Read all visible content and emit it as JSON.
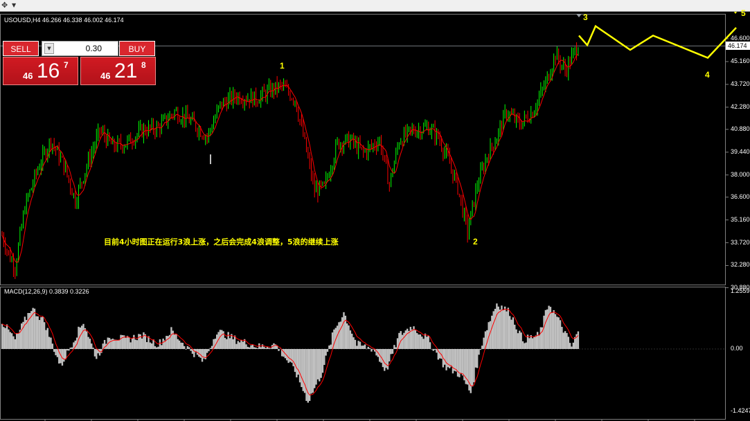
{
  "window": {
    "icon": "crosshair-icon",
    "menu_chevron": "chevron-down-icon"
  },
  "chart_header": {
    "symbol_text": "USOUSD,H4  46.266 46.338 46.002 46.174"
  },
  "trade_panel": {
    "sell_label": "SELL",
    "buy_label": "BUY",
    "lot_value": "0.30",
    "sell_price": {
      "prefix": "46",
      "big": "16",
      "sup": "7"
    },
    "buy_price": {
      "prefix": "46",
      "big": "21",
      "sup": "8"
    }
  },
  "annotation": "目前4小时图正在运行3浪上涨，之后会完成4浪调整，5浪的继续上涨",
  "price_axis": [
    "46.600",
    "45.160",
    "43.720",
    "42.280",
    "40.880",
    "39.440",
    "38.000",
    "36.600",
    "35.160",
    "33.720",
    "32.280",
    "30.880"
  ],
  "current_price": "46.174",
  "wave_labels": [
    "1",
    "2",
    "3",
    "4",
    "5"
  ],
  "macd": {
    "header": "MACD(12,26,9) 0.3839 0.3226",
    "axis": [
      "1.2559",
      "0.00",
      "-1.4247"
    ]
  },
  "colors": {
    "bull": "#00ff00",
    "bear": "#ff0000",
    "signal": "#ff0000",
    "histogram": "#c0c0c0",
    "wave": "#ffff00",
    "grid": "#808080"
  },
  "chart_data": {
    "type": "candlestick",
    "symbol": "USOUSD",
    "timeframe": "H4",
    "last": {
      "open": 46.266,
      "high": 46.338,
      "low": 46.002,
      "close": 46.174
    },
    "y_axis_range": [
      30.88,
      47.3
    ],
    "anchors": [
      {
        "i": 0,
        "v": 34.2
      },
      {
        "i": 4,
        "v": 33.0
      },
      {
        "i": 8,
        "v": 32.2
      },
      {
        "i": 14,
        "v": 36.0
      },
      {
        "i": 22,
        "v": 38.4
      },
      {
        "i": 30,
        "v": 40.2
      },
      {
        "i": 38,
        "v": 38.6
      },
      {
        "i": 45,
        "v": 36.4
      },
      {
        "i": 52,
        "v": 38.6
      },
      {
        "i": 60,
        "v": 40.8
      },
      {
        "i": 68,
        "v": 39.8
      },
      {
        "i": 76,
        "v": 40.0
      },
      {
        "i": 86,
        "v": 40.8
      },
      {
        "i": 96,
        "v": 41.0
      },
      {
        "i": 106,
        "v": 42.0
      },
      {
        "i": 116,
        "v": 41.4
      },
      {
        "i": 126,
        "v": 40.4
      },
      {
        "i": 134,
        "v": 42.4
      },
      {
        "i": 144,
        "v": 43.0
      },
      {
        "i": 156,
        "v": 42.8
      },
      {
        "i": 166,
        "v": 43.4
      },
      {
        "i": 172,
        "v": 43.6
      },
      {
        "i": 180,
        "v": 42.8
      },
      {
        "i": 186,
        "v": 40.0
      },
      {
        "i": 192,
        "v": 37.0
      },
      {
        "i": 198,
        "v": 37.2
      },
      {
        "i": 206,
        "v": 40.0
      },
      {
        "i": 214,
        "v": 40.2
      },
      {
        "i": 222,
        "v": 39.4
      },
      {
        "i": 232,
        "v": 40.2
      },
      {
        "i": 238,
        "v": 37.4
      },
      {
        "i": 244,
        "v": 40.2
      },
      {
        "i": 252,
        "v": 40.8
      },
      {
        "i": 262,
        "v": 41.0
      },
      {
        "i": 268,
        "v": 40.4
      },
      {
        "i": 274,
        "v": 39.0
      },
      {
        "i": 280,
        "v": 37.2
      },
      {
        "i": 286,
        "v": 34.4
      },
      {
        "i": 292,
        "v": 37.4
      },
      {
        "i": 298,
        "v": 39.2
      },
      {
        "i": 304,
        "v": 40.4
      },
      {
        "i": 310,
        "v": 42.0
      },
      {
        "i": 318,
        "v": 41.2
      },
      {
        "i": 326,
        "v": 42.0
      },
      {
        "i": 334,
        "v": 43.8
      },
      {
        "i": 340,
        "v": 45.6
      },
      {
        "i": 346,
        "v": 44.6
      },
      {
        "i": 354,
        "v": 46.2
      }
    ],
    "macd_anchors": [
      {
        "i": 0,
        "v": 0.6
      },
      {
        "i": 8,
        "v": 0.2
      },
      {
        "i": 18,
        "v": 0.9
      },
      {
        "i": 26,
        "v": 0.6
      },
      {
        "i": 36,
        "v": -0.4
      },
      {
        "i": 44,
        "v": 0.2
      },
      {
        "i": 50,
        "v": 0.6
      },
      {
        "i": 58,
        "v": -0.2
      },
      {
        "i": 66,
        "v": 0.3
      },
      {
        "i": 76,
        "v": 0.2
      },
      {
        "i": 86,
        "v": 0.3
      },
      {
        "i": 96,
        "v": 0.1
      },
      {
        "i": 104,
        "v": 0.4
      },
      {
        "i": 112,
        "v": 0.1
      },
      {
        "i": 124,
        "v": -0.3
      },
      {
        "i": 132,
        "v": 0.4
      },
      {
        "i": 144,
        "v": 0.2
      },
      {
        "i": 158,
        "v": 0.05
      },
      {
        "i": 168,
        "v": 0.1
      },
      {
        "i": 180,
        "v": -0.5
      },
      {
        "i": 188,
        "v": -1.2
      },
      {
        "i": 196,
        "v": -0.6
      },
      {
        "i": 204,
        "v": 0.4
      },
      {
        "i": 210,
        "v": 0.8
      },
      {
        "i": 218,
        "v": 0.1
      },
      {
        "i": 228,
        "v": 0.0
      },
      {
        "i": 236,
        "v": -0.5
      },
      {
        "i": 244,
        "v": 0.3
      },
      {
        "i": 252,
        "v": 0.5
      },
      {
        "i": 262,
        "v": 0.2
      },
      {
        "i": 272,
        "v": -0.4
      },
      {
        "i": 282,
        "v": -0.6
      },
      {
        "i": 288,
        "v": -1.0
      },
      {
        "i": 296,
        "v": 0.3
      },
      {
        "i": 304,
        "v": 1.0
      },
      {
        "i": 312,
        "v": 0.8
      },
      {
        "i": 320,
        "v": 0.2
      },
      {
        "i": 330,
        "v": 0.3
      },
      {
        "i": 336,
        "v": 1.0
      },
      {
        "i": 344,
        "v": 0.5
      },
      {
        "i": 350,
        "v": 0.05
      },
      {
        "i": 354,
        "v": 0.38
      }
    ],
    "forecast_path": [
      {
        "label": "3",
        "value": 46.8
      },
      {
        "value": 46.2
      },
      {
        "value": 47.4
      },
      {
        "value": 45.9
      },
      {
        "value": 46.8
      },
      {
        "label": "4",
        "value": 45.4
      },
      {
        "label": "5",
        "value": 47.3
      }
    ]
  }
}
